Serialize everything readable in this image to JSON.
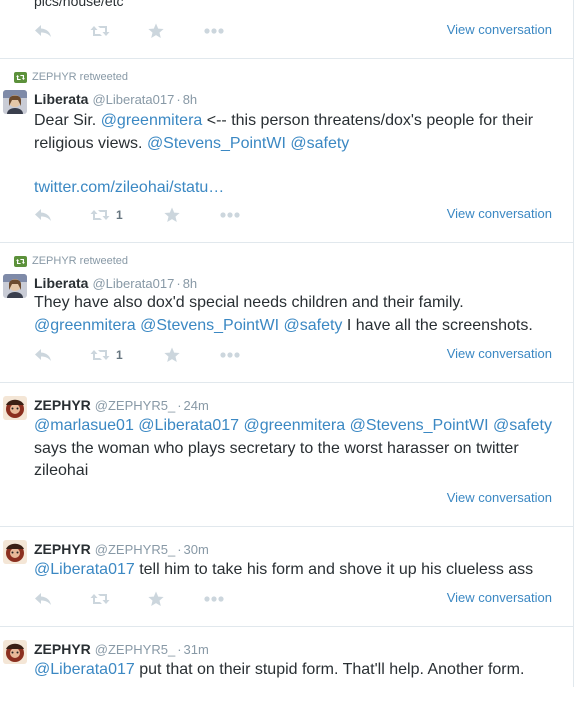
{
  "tweets": [
    {
      "partial_text": "pics/house/etc",
      "view_label": "View conversation"
    },
    {
      "retweeted_by": "ZEPHYR retweeted",
      "name": "Liberata",
      "handle": "@Liberata017",
      "time": "8h",
      "text_parts": [
        "Dear Sir. ",
        "@greenmitera",
        " <-- this person threatens/dox's people for their religious views. ",
        "@Stevens_PointWI",
        " ",
        "@safety"
      ],
      "link": "twitter.com/zileohai/statu…",
      "retweet_count": "1",
      "view_label": "View conversation"
    },
    {
      "retweeted_by": "ZEPHYR retweeted",
      "name": "Liberata",
      "handle": "@Liberata017",
      "time": "8h",
      "text_parts": [
        "They have also dox'd special needs children and their family. ",
        "@greenmitera",
        " ",
        "@Stevens_PointWI",
        " ",
        "@safety",
        " I have all the screenshots."
      ],
      "retweet_count": "1",
      "view_label": "View conversation"
    },
    {
      "name": "ZEPHYR",
      "handle": "@ZEPHYR5_",
      "time": "24m",
      "text_parts": [
        "@marlasue01",
        " ",
        "@Liberata017",
        " ",
        "@greenmitera",
        " ",
        "@Stevens_PointWI",
        " ",
        "@safety",
        " says the woman who plays secretary to the worst harasser on twitter zileohai"
      ],
      "view_label": "View conversation"
    },
    {
      "name": "ZEPHYR",
      "handle": "@ZEPHYR5_",
      "time": "30m",
      "text_parts": [
        "@Liberata017",
        " tell him to take his form and shove it up his clueless ass"
      ],
      "view_label": "View conversation"
    },
    {
      "name": "ZEPHYR",
      "handle": "@ZEPHYR5_",
      "time": "31m",
      "text_parts": [
        "@Liberata017",
        " put that on their stupid form. That'll help. Another form."
      ]
    }
  ],
  "colors": {
    "link": "#3b88c3",
    "muted": "#8899a6",
    "retweet_green": "#5c913b",
    "text": "#292f33"
  },
  "icons": [
    "reply-icon",
    "retweet-icon",
    "favorite-icon",
    "more-icon"
  ]
}
